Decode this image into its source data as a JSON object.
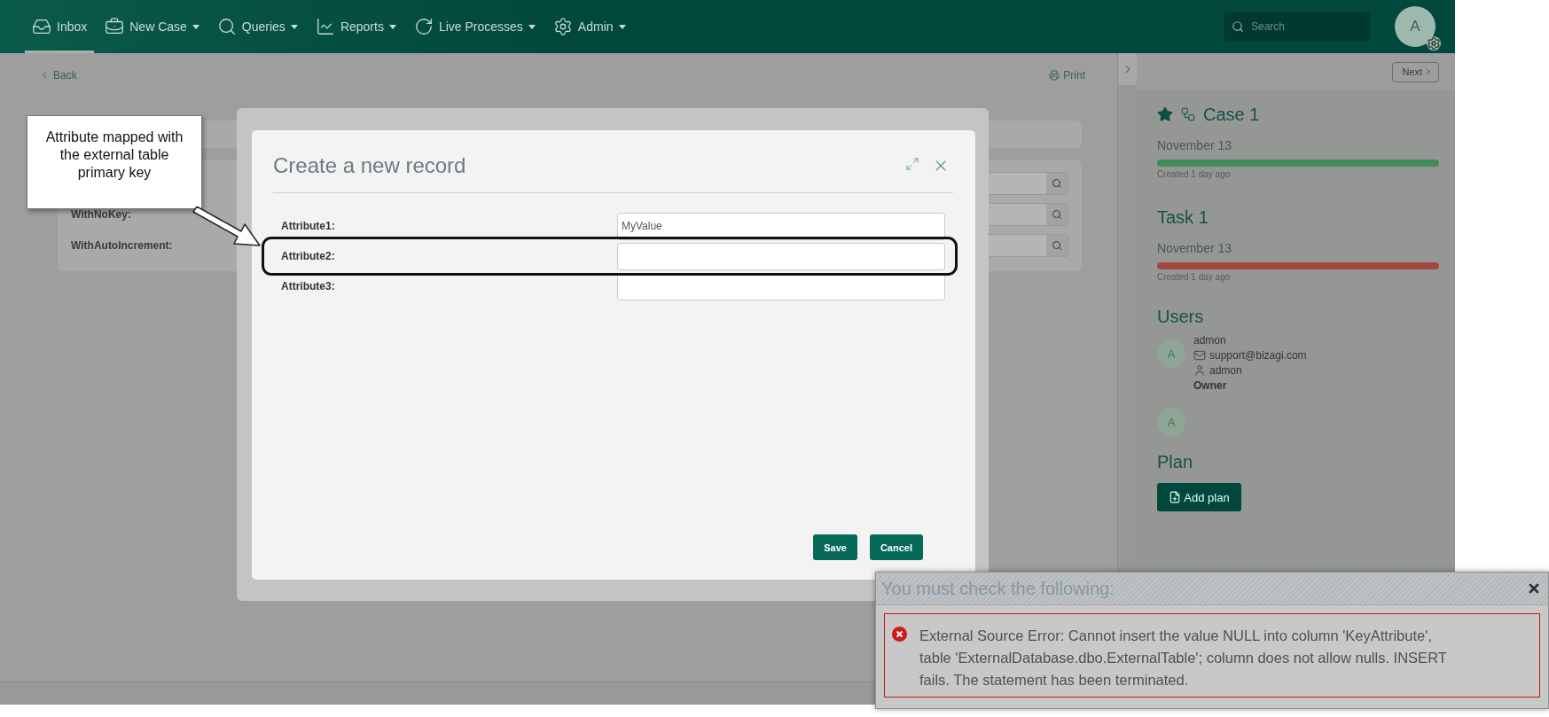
{
  "nav": {
    "items": [
      {
        "label": "Inbox",
        "dropdown": false,
        "selected": true
      },
      {
        "label": "New Case",
        "dropdown": true,
        "selected": false
      },
      {
        "label": "Queries",
        "dropdown": true,
        "selected": false
      },
      {
        "label": "Reports",
        "dropdown": true,
        "selected": false
      },
      {
        "label": "Live Processes",
        "dropdown": true,
        "selected": false
      },
      {
        "label": "Admin",
        "dropdown": true,
        "selected": false
      }
    ],
    "search": {
      "placeholder": "Search"
    },
    "avatar": "A"
  },
  "toolbar": {
    "back": "Back",
    "print": "Print",
    "next": "Next"
  },
  "background_form": {
    "rows": [
      {
        "kind": "unlabeled"
      },
      {
        "kind": "labeled",
        "label": "WithNoKey:"
      },
      {
        "kind": "labeled",
        "label": "WithAutoIncrement:"
      }
    ]
  },
  "modal": {
    "title": "Create a new record",
    "fields": [
      {
        "label": "Attribute1:",
        "value": "MyValue",
        "highlighted": false
      },
      {
        "label": "Attribute2:",
        "highlighted": true
      },
      {
        "label": "Attribute3:",
        "highlighted": false
      }
    ],
    "buttons": [
      "Save",
      "Cancel"
    ]
  },
  "callout": {
    "text": "Attribute mapped with the external table primary key"
  },
  "side_panel": {
    "items": [
      {
        "kind": "case",
        "title": "Case 1",
        "date": "November 13",
        "created": "Created 1 day ago",
        "color": "#3f8b5a"
      },
      {
        "kind": "task",
        "title": "Task 1",
        "date": "November 13",
        "created": "Created 1 day ago",
        "color": "#a4463f"
      }
    ],
    "users": {
      "title": "Users",
      "list": [
        {
          "kind": "detailed",
          "initial": "A",
          "name": "admon",
          "email": "support@bizagi.com",
          "login": "admon",
          "role": "Owner"
        },
        {
          "kind": "compact",
          "initial": "A"
        }
      ]
    },
    "plan": {
      "title": "Plan",
      "button": "Add plan"
    }
  },
  "error_dialog": {
    "title": "You must check the following:",
    "message": "External Source Error: Cannot insert the value NULL into column 'KeyAttribute', table 'ExternalDatabase.dbo.ExternalTable'; column does not allow nulls. INSERT fails. The statement has been terminated."
  }
}
